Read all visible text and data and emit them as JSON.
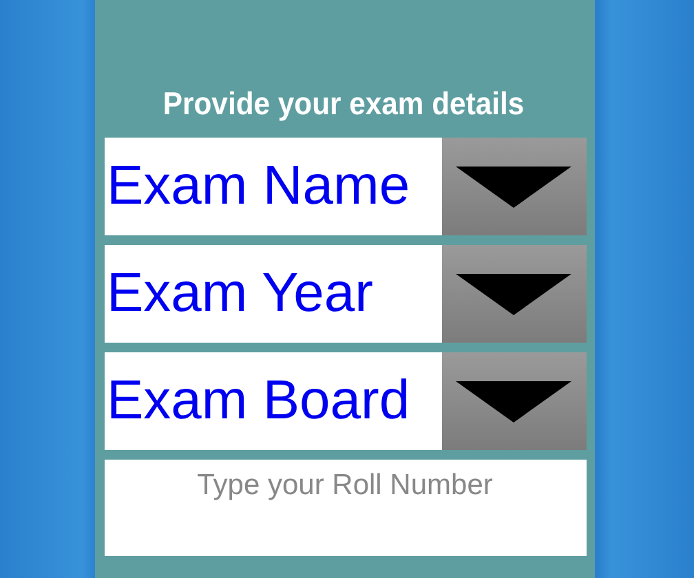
{
  "heading": "Provide your exam details",
  "dropdowns": [
    {
      "label": "Exam Name"
    },
    {
      "label": "Exam Year"
    },
    {
      "label": "Exam Board"
    }
  ],
  "roll_number": {
    "placeholder": "Type your Roll Number"
  }
}
